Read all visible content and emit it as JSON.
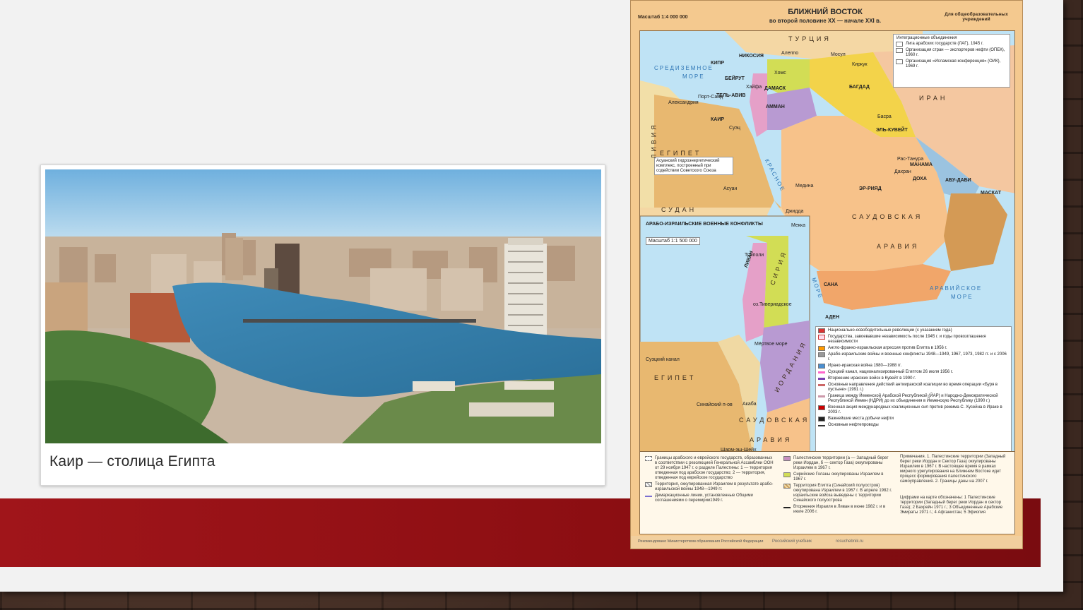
{
  "photo": {
    "caption": "Каир — столица Египта"
  },
  "map": {
    "scale": "Масштаб 1:4 000 000",
    "title": "БЛИЖНИЙ ВОСТОК",
    "subtitle": "во второй половине XX — начале XXI в.",
    "edu_note": "Для общеобразовательных учреждений",
    "integration_legend": {
      "heading": "Интеграционные объединения",
      "items": [
        "Лига арабских государств (ЛАГ), 1945 г.",
        "Организация стран — экспортеров нефти (ОПЕК), 1960 г.",
        "Организация «Исламская конференция» (ОИК), 1969 г."
      ]
    },
    "seas": [
      "СРЕДИЗЕМНОЕ",
      "МОРЕ",
      "КРАСНОЕ",
      "МОРЕ",
      "АРАВИЙСКОЕ",
      "МОРЕ"
    ],
    "countries": [
      "ТУРЦИЯ",
      "ИРАН",
      "ЕГИПЕТ",
      "СУДАН",
      "САУДОВСКАЯ",
      "АРАВИЯ",
      "ЛИВИЯ",
      "КИПР"
    ],
    "cities": [
      "НИКОСИЯ",
      "БЕЙРУТ",
      "ДАМАСК",
      "ТЕЛЬ-АВИВ",
      "АММАН",
      "КАИР",
      "БАГДАД",
      "ЭЛЬ-КУВЕЙТ",
      "МАНАМА",
      "ДОХА",
      "АБУ-ДАБИ",
      "МАСКАТ",
      "ЭР-РИЯД",
      "САНА",
      "АДЕН",
      "Александрия",
      "Порт-Саид",
      "Суэц",
      "Асуан",
      "Хайфа",
      "Алеппо",
      "Хомс",
      "Мосул",
      "Киркук",
      "Басра",
      "Джидда",
      "Мекка",
      "Медина",
      "Рас-Танура",
      "Дахран"
    ],
    "aswan_note": "Асуанский гидроэнергетический комплекс, построенный при содействии Советского Союза",
    "inset": {
      "title": "АРАБО-ИЗРАИЛЬСКИЕ ВОЕННЫЕ КОНФЛИКТЫ",
      "scale": "Масштаб 1:1 500 000",
      "labels": [
        "СИРИЯ",
        "ЛИВАН",
        "ИОРДАНИЯ",
        "ЕГИПЕТ",
        "САУДОВСКАЯ",
        "АРАВИЯ",
        "Синайский п-ов",
        "Суэцкий канал",
        "оз.Тивериадское",
        "Мёртвое море",
        "Акаба",
        "Шарм-эш-Шейх",
        "Триполи"
      ]
    },
    "main_legend": [
      "Национально-освободительные революции (с указанием года)",
      "Государства, завоевавшие независимость после 1945 г. и годы провозглашения независимости",
      "Англо-франко-израильская агрессия против Египта в 1956 г.",
      "Арабо-израильские войны и военные конфликты 1948—1949, 1967, 1973, 1982 гг. и с 2006 г.",
      "Ирано-иракская война 1980—1988 гг.",
      "Суэцкий канал, национализированный Египтом 26 июля 1956 г.",
      "Вторжение иракских войск в Кувейт в 1990 г.",
      "Основные направления действий антииракской коалиции во время операции «Буря в пустыне» (1991 г.)",
      "Граница между Йеменской Арабской Республикой (ЙАР) и Народно-Демократической Республикой Йемен (НДРЙ) до их объединения в Йеменскую Республику (1990 г.)",
      "Военная акция международных коалиционных сил против режима С. Хусейна в Ираке в 2003 г.",
      "Важнейшие места добычи нефти",
      "Основные нефтепроводы"
    ],
    "bottom_legend_left": [
      "Границы арабского и еврейского государств, образованных в соответствии с резолюцией Генеральной Ассамблеи ООН от 29 ноября 1947 г. о разделе Палестины: 1 — территория отведенная под арабское государство; 2 — территория, отведенная под еврейское государство",
      "Территория, оккупированная Израилем в результате арабо-израильской войны 1948—1949 гг.",
      "Демаркационные линии, установленные Общими соглашениями о перемирии1949 г."
    ],
    "bottom_legend_mid": [
      "Палестинские территории (а — Западный берег реки Иордан, б — сектор Газа) оккупированы Израилем в 1967 г.",
      "Сирийские Голаны оккупированы Израилем в 1967 г.",
      "Территория Египта (Синайский полуостров) оккупирована Израилем в 1967 г. В апреле 1982 г. израильские войска выведены с территории Синайского полуострова",
      "Вторжения Израиля в Ливан в июне 1982 г. и в июле 2006 г."
    ],
    "bottom_notes": "Примечания. 1. Палестинские территории (Западный берег реки Иордан и Сектор Газа) оккупированы Израилем в 1967 г. В настоящее время в рамках мирного урегулирования на Ближнем Востоке идет процесс формирования палестинского самоуправления. 2. Границы даны на 2007 г.",
    "bottom_numbers": "Цифрами на карте обозначены: 1 Палестинские территории (Западный берег реки Иордан и сектор Газа); 2 Бахрейн 1971 г.; 3 Объединенные Арабские Эмираты 1971 г.; 4 Афганистан; 5 Эфиопия",
    "footer_text": "Рекомендовано Министерством образования Российской Федерации",
    "footer_site": "rosuchebnik.ru",
    "footer_pub": "Российский учебник"
  },
  "colors": {
    "red_band": "#8b0e12",
    "map_bg": "#f4c98f",
    "sea": "#bfe3f5",
    "saudi": "#f7c28a",
    "egypt": "#e8b870",
    "iraq": "#f3d34a",
    "syria": "#d2dd55",
    "israel": "#e5a0c8",
    "jordan": "#b89ad2"
  }
}
